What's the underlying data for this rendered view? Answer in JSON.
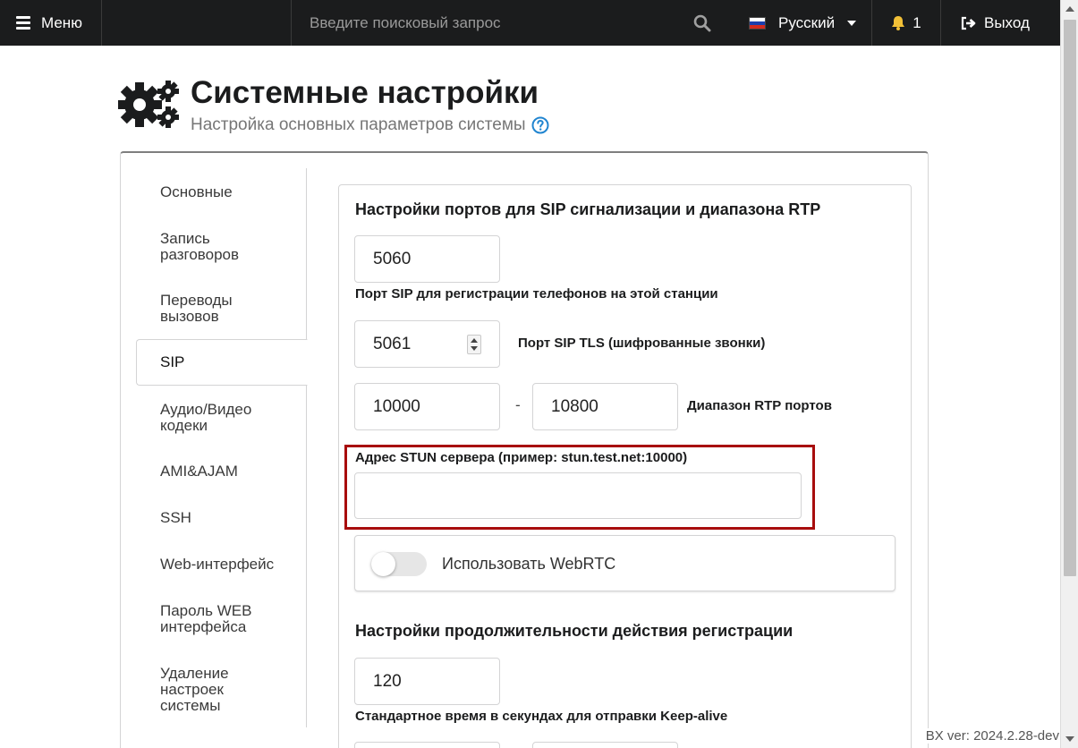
{
  "topbar": {
    "menu_label": "Меню",
    "search_placeholder": "Введите поисковый запрос",
    "language": "Русский",
    "notifications_count": "1",
    "logout_label": "Выход"
  },
  "header": {
    "title": "Системные настройки",
    "subtitle": "Настройка основных параметров системы"
  },
  "sidebar": {
    "items": [
      {
        "label": "Основные"
      },
      {
        "label": "Запись разговоров"
      },
      {
        "label": "Переводы вызовов"
      },
      {
        "label": "SIP"
      },
      {
        "label": "Аудио/Видео кодеки"
      },
      {
        "label": "AMI&AJAM"
      },
      {
        "label": "SSH"
      },
      {
        "label": "Web-интерфейс"
      },
      {
        "label": "Пароль WEB интерфейса"
      },
      {
        "label": "Удаление настроек системы"
      }
    ],
    "active": "SIP"
  },
  "sip": {
    "ports_title": "Настройки портов для SIP сигнализации и диапазона RTP",
    "sip_port": "5060",
    "sip_port_label": "Порт SIP для регистрации телефонов на этой станции",
    "tls_port": "5061",
    "tls_port_label": "Порт SIP TLS (шифрованные звонки)",
    "rtp_start": "10000",
    "rtp_separator": "-",
    "rtp_end": "10800",
    "rtp_label": "Диапазон RTP портов",
    "stun_label": "Адрес STUN сервера (пример: stun.test.net:10000)",
    "stun_value": "",
    "webrtc_label": "Использовать WebRTC",
    "webrtc_enabled": false,
    "registration_title": "Настройки продолжительности действия регистрации",
    "keepalive_value": "120",
    "keepalive_label": "Стандартное время в секундах для отправки Keep-alive"
  },
  "footer": {
    "version": "BX ver: 2024.2.28-dev"
  }
}
